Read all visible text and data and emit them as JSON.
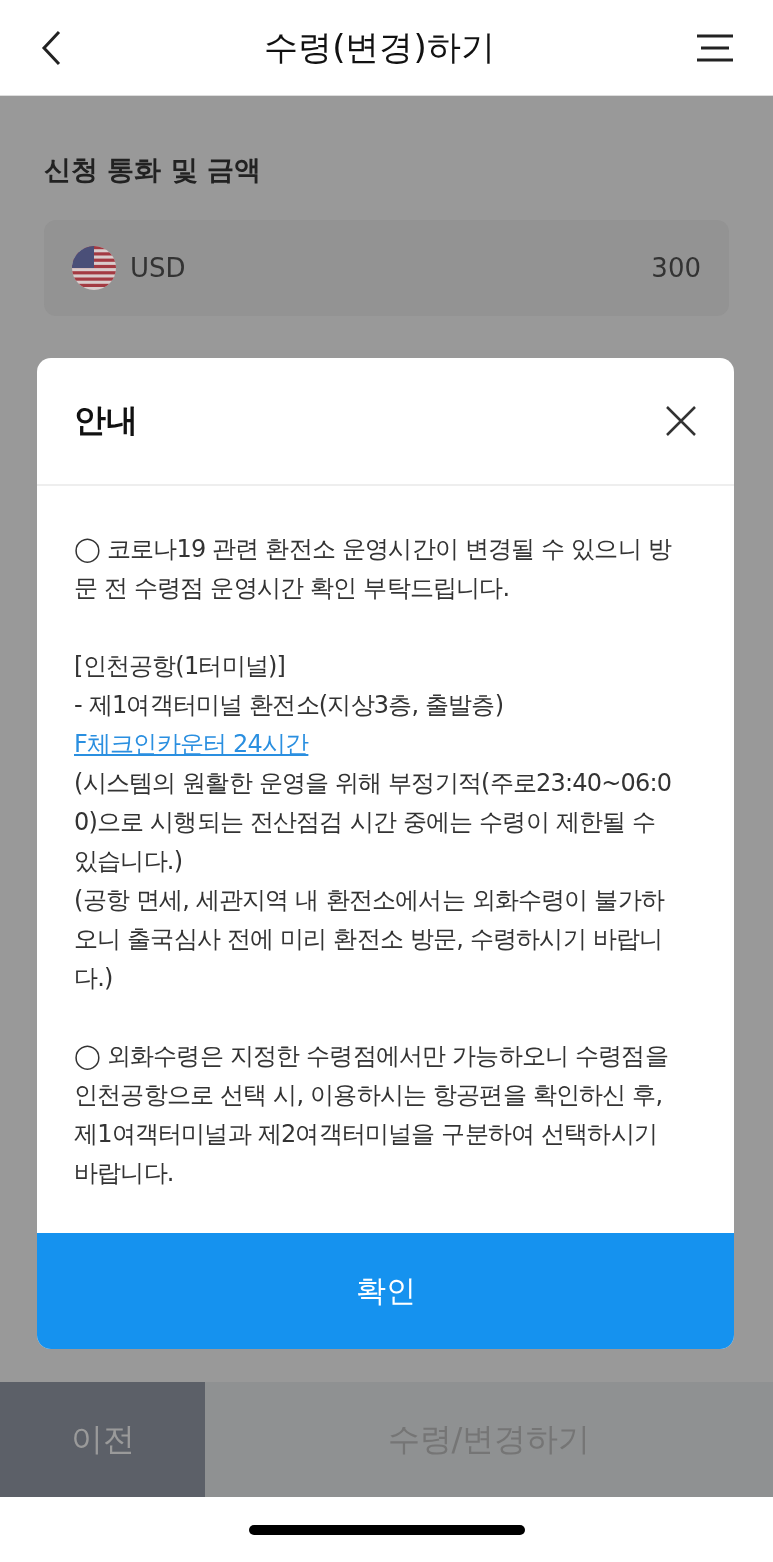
{
  "header": {
    "title": "수령(변경)하기"
  },
  "section": {
    "title": "신청 통화 및 금액"
  },
  "currency": {
    "code": "USD",
    "amount": "300"
  },
  "dialog": {
    "title": "안내",
    "groups": [
      [
        {
          "kind": "text",
          "text": "◯ 코로나19 관련 환전소 운영시간이 변경될 수 있으니 방문 전 수령점 운영시간 확인 부탁드립니다."
        }
      ],
      [
        {
          "kind": "text",
          "text": "[인천공항(1터미널)]"
        },
        {
          "kind": "link",
          "text": "- 제1여객터미널 환전소(지상3층, 출발층) ",
          "link": "F체크인카운터 24시간"
        },
        {
          "kind": "text",
          "text": "(시스템의 원활한 운영을 위해 부정기적(주로23:40~06:00)으로 시행되는 전산점검 시간 중에는 수령이 제한될 수 있습니다.)"
        },
        {
          "kind": "text",
          "text": "(공항 면세, 세관지역 내 환전소에서는 외화수령이 불가하오니 출국심사 전에 미리 환전소 방문, 수령하시기 바랍니다.)"
        }
      ],
      [
        {
          "kind": "text",
          "text": "◯ 외화수령은 지정한 수령점에서만 가능하오니 수령점을 인천공항으로 선택 시, 이용하시는 항공편을 확인하신 후, 제1여객터미널과 제2여객터미널을 구분하여 선택하시기 바랍니다."
        }
      ]
    ],
    "confirm": "확인"
  },
  "footer": {
    "prev": "이전",
    "submit": "수령/변경하기"
  }
}
